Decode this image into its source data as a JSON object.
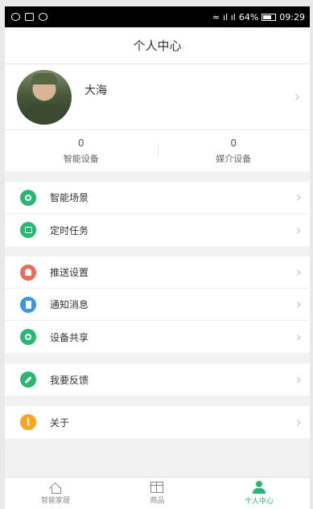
{
  "status_bar": {
    "battery": "64%",
    "time": "09:29",
    "signal": "ıl ıl"
  },
  "header": {
    "title": "个人中心"
  },
  "profile": {
    "name": "大海"
  },
  "stats": [
    {
      "value": "0",
      "label": "智能设备"
    },
    {
      "value": "0",
      "label": "媒介设备"
    }
  ],
  "menu_groups": [
    [
      {
        "label": "智能场景",
        "icon": "scene-icon",
        "color": "#2bb673"
      },
      {
        "label": "定时任务",
        "icon": "timer-task-icon",
        "color": "#2bb673"
      }
    ],
    [
      {
        "label": "推送设置",
        "icon": "bell-icon",
        "color": "#f06a5a"
      },
      {
        "label": "通知消息",
        "icon": "notification-icon",
        "color": "#3b97e3"
      },
      {
        "label": "设备共享",
        "icon": "share-icon",
        "color": "#2bb673"
      }
    ],
    [
      {
        "label": "我要反馈",
        "icon": "pencil-icon",
        "color": "#2bb673"
      }
    ],
    [
      {
        "label": "关于",
        "icon": "info-icon",
        "color": "#f5a623"
      }
    ]
  ],
  "tabs": [
    {
      "label": "智能家居",
      "icon": "home-icon",
      "active": false
    },
    {
      "label": "商品",
      "icon": "gift-icon",
      "active": false
    },
    {
      "label": "个人中心",
      "icon": "user-icon",
      "active": true
    }
  ],
  "colors": {
    "accent": "#2bb673",
    "red": "#f06a5a",
    "blue": "#3b97e3",
    "orange": "#f5a623"
  }
}
